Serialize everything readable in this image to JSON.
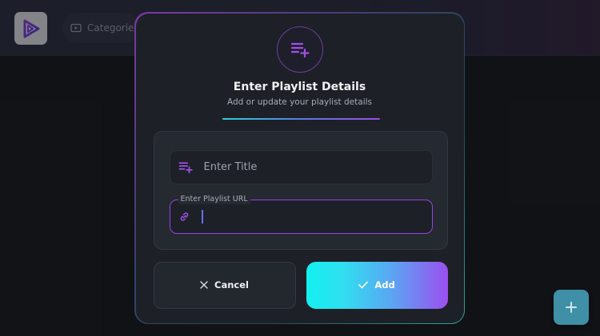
{
  "background": {
    "categories_label": "Categories"
  },
  "modal": {
    "title": "Enter Playlist Details",
    "subtitle": "Add or update your playlist details",
    "title_field": {
      "value": "",
      "placeholder": "Enter Title"
    },
    "url_field": {
      "label": "Enter Playlist URL",
      "value": ""
    },
    "cancel_label": "Cancel",
    "add_label": "Add"
  },
  "icons": {
    "logo": "play-logo-icon",
    "categories": "video-icon",
    "header": "playlist-add-icon",
    "title_field": "playlist-add-icon",
    "url_field": "link-icon",
    "cancel": "close-icon",
    "add": "check-icon",
    "fab": "plus-icon"
  },
  "colors": {
    "accent_purple": "#9b3fe6",
    "accent_cyan": "#12f0ef",
    "background": "#17191d",
    "modal": "#1d2026",
    "fab": "#3f8fa6"
  }
}
